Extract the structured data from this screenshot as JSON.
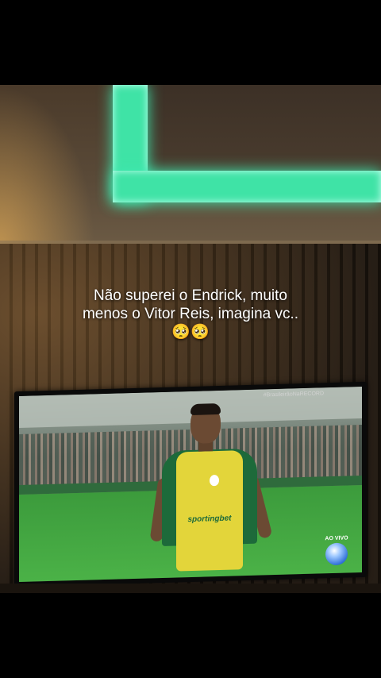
{
  "caption": {
    "line1": "Não superei o Endrick, muito",
    "line2": "menos o Vitor Reis, imagina vc..",
    "line3": "🥺🥺"
  },
  "tv": {
    "watermark": "#BrasileirãoNaRECORD",
    "sponsor": "sportingbet",
    "live_label": "AO VIVO",
    "live_icon": "record-logo-icon"
  },
  "colors": {
    "led": "#3fe3a6",
    "jersey": "#1d6a3a",
    "bib": "#e3d53a"
  }
}
